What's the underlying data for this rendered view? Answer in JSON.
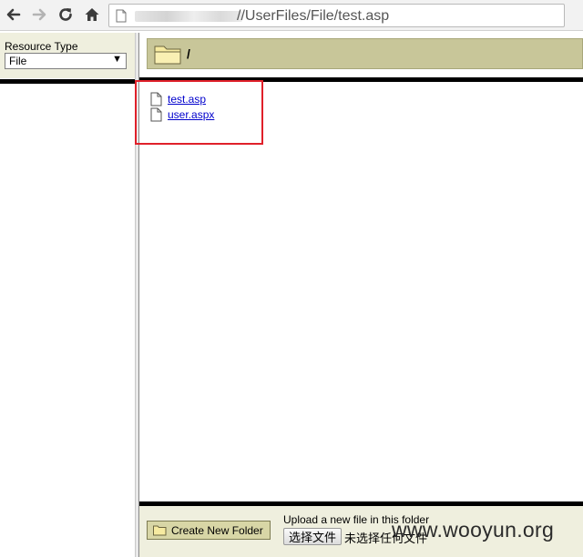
{
  "browser": {
    "address_text": "//UserFiles/File/test.asp"
  },
  "left_panel": {
    "resource_type_label": "Resource Type",
    "resource_type_value": "File"
  },
  "folder_bar": {
    "path": "/"
  },
  "files": [
    {
      "name": "test.asp"
    },
    {
      "name": "user.aspx"
    }
  ],
  "bottom_bar": {
    "create_folder_label": "Create New Folder",
    "upload_label": "Upload a new file in this folder",
    "choose_file_label": "选择文件",
    "no_file_label": "未选择任何文件"
  },
  "watermark": "www.wooyun.org",
  "colors": {
    "highlight": "#e0202a",
    "folder_bar": "#c8c699",
    "link": "#0000cc"
  }
}
